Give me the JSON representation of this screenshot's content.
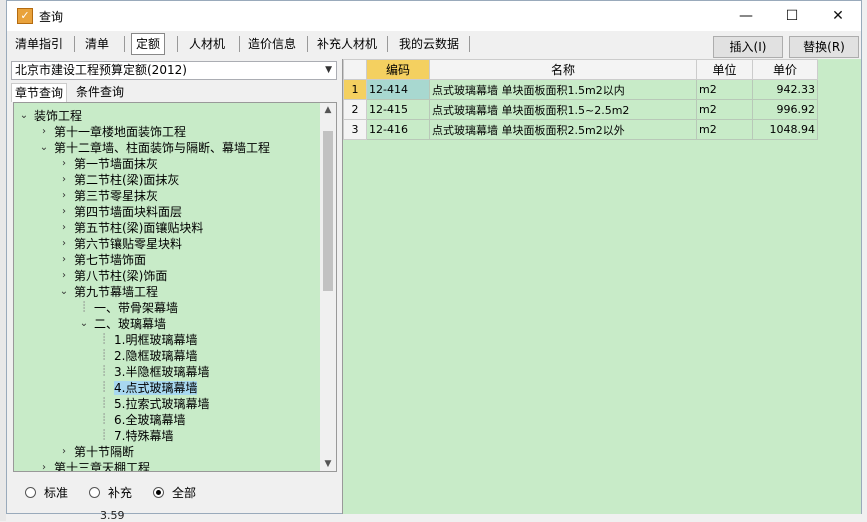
{
  "window": {
    "title": "查询",
    "minimize": "—",
    "maximize": "☐",
    "close": "✕"
  },
  "tabs": [
    "清单指引",
    "清单",
    "定额",
    "人材机",
    "造价信息",
    "补充人材机",
    "我的云数据"
  ],
  "buttons": {
    "insert": "插入(I)",
    "replace": "替换(R)"
  },
  "combo": {
    "value": "北京市建设工程预算定额(2012)"
  },
  "subtabs": [
    "章节查询",
    "条件查询"
  ],
  "tree": [
    {
      "label": "装饰工程",
      "level": 0,
      "toggle": "open"
    },
    {
      "label": "第十一章楼地面装饰工程",
      "level": 1,
      "toggle": "closed"
    },
    {
      "label": "第十二章墙、柱面装饰与隔断、幕墙工程",
      "level": 1,
      "toggle": "open"
    },
    {
      "label": "第一节墙面抹灰",
      "level": 2,
      "toggle": "closed"
    },
    {
      "label": "第二节柱(梁)面抹灰",
      "level": 2,
      "toggle": "closed"
    },
    {
      "label": "第三节零星抹灰",
      "level": 2,
      "toggle": "closed"
    },
    {
      "label": "第四节墙面块料面层",
      "level": 2,
      "toggle": "closed"
    },
    {
      "label": "第五节柱(梁)面镶贴块料",
      "level": 2,
      "toggle": "closed"
    },
    {
      "label": "第六节镶贴零星块料",
      "level": 2,
      "toggle": "closed"
    },
    {
      "label": "第七节墙饰面",
      "level": 2,
      "toggle": "closed"
    },
    {
      "label": "第八节柱(梁)饰面",
      "level": 2,
      "toggle": "closed"
    },
    {
      "label": "第九节幕墙工程",
      "level": 2,
      "toggle": "open"
    },
    {
      "label": "一、带骨架幕墙",
      "level": 3,
      "toggle": "none"
    },
    {
      "label": "二、玻璃幕墙",
      "level": 3,
      "toggle": "open"
    },
    {
      "label": "1.明框玻璃幕墙",
      "level": 4,
      "toggle": "none"
    },
    {
      "label": "2.隐框玻璃幕墙",
      "level": 4,
      "toggle": "none"
    },
    {
      "label": "3.半隐框玻璃幕墙",
      "level": 4,
      "toggle": "none"
    },
    {
      "label": "4.点式玻璃幕墙",
      "level": 4,
      "toggle": "none",
      "selected": true
    },
    {
      "label": "5.拉索式玻璃幕墙",
      "level": 4,
      "toggle": "none"
    },
    {
      "label": "6.全玻璃幕墙",
      "level": 4,
      "toggle": "none"
    },
    {
      "label": "7.特殊幕墙",
      "level": 4,
      "toggle": "none"
    },
    {
      "label": "第十节隔断",
      "level": 2,
      "toggle": "closed"
    },
    {
      "label": "第十三章天棚工程",
      "level": 1,
      "toggle": "closed"
    }
  ],
  "radios": [
    {
      "label": "标准",
      "checked": false
    },
    {
      "label": "补充",
      "checked": false
    },
    {
      "label": "全部",
      "checked": true
    }
  ],
  "table": {
    "headers": [
      "编码",
      "名称",
      "单位",
      "单价"
    ],
    "rows": [
      {
        "num": "1",
        "code": "12-414",
        "name": "点式玻璃幕墙 单块面板面积1.5m2以内",
        "unit": "m2",
        "price": "942.33"
      },
      {
        "num": "2",
        "code": "12-415",
        "name": "点式玻璃幕墙 单块面板面积1.5~2.5m2",
        "unit": "m2",
        "price": "996.92"
      },
      {
        "num": "3",
        "code": "12-416",
        "name": "点式玻璃幕墙 单块面板面积2.5m2以外",
        "unit": "m2",
        "price": "1048.94"
      }
    ]
  },
  "background_fragments": {
    "bottom_value": "3.59"
  }
}
